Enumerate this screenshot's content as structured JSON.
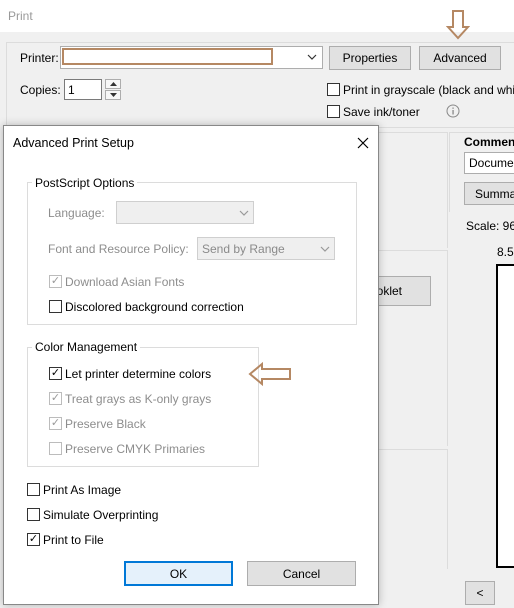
{
  "print_window": {
    "title": "Print",
    "printer_label": "Printer:",
    "properties_label": "Properties",
    "advanced_label": "Advanced",
    "copies_label": "Copies:",
    "copies_value": "1",
    "grayscale_label": "Print in grayscale (black and whi",
    "save_ink_label": "Save ink/toner",
    "comments_label": "Commen",
    "comments_value": "Docume",
    "summarize_label": "Summa",
    "scale_label": "Scale: 96",
    "page_size_label": "8.5",
    "booklet_label": "oklet",
    "prev_page_label": "<"
  },
  "dialog": {
    "title": "Advanced Print Setup",
    "close_icon": "close-icon",
    "postscript": {
      "title": "PostScript Options",
      "language_label": "Language:",
      "language_value": "",
      "font_policy_label": "Font and Resource Policy:",
      "font_policy_value": "Send by Range",
      "download_asian_label": "Download Asian Fonts",
      "discolored_label": "Discolored background correction"
    },
    "color": {
      "title": "Color Management",
      "let_printer_label": "Let printer determine colors",
      "treat_grays_label": "Treat grays as K-only grays",
      "preserve_black_label": "Preserve Black",
      "preserve_cmyk_label": "Preserve CMYK Primaries"
    },
    "print_as_image_label": "Print As Image",
    "simulate_label": "Simulate Overprinting",
    "print_to_file_label": "Print to File",
    "ok_label": "OK",
    "cancel_label": "Cancel"
  },
  "annotations": {
    "arrow_color": "#b58863"
  }
}
